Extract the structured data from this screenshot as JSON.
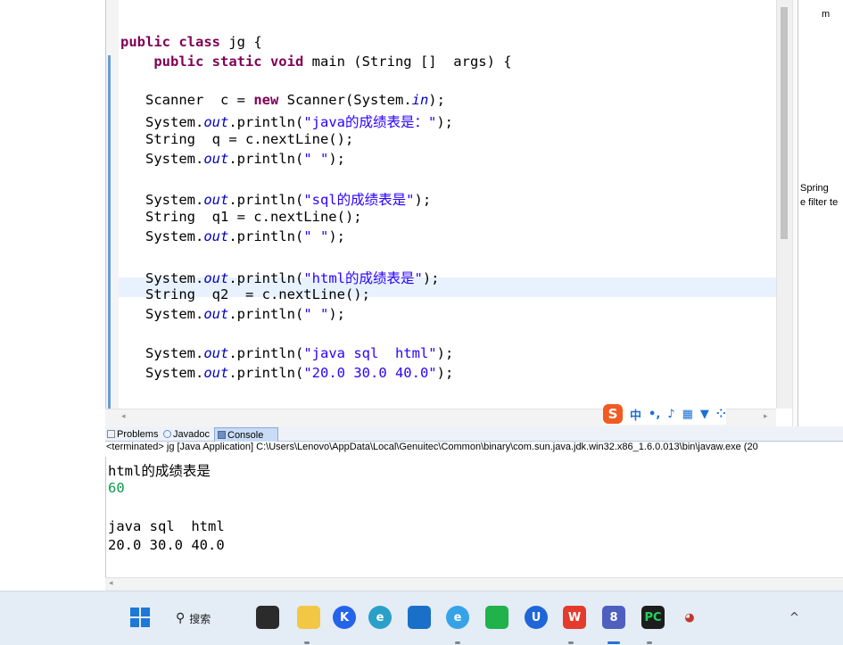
{
  "editor": {
    "lines": [
      {
        "parts": [
          [
            "kw",
            "public class "
          ],
          [
            "n",
            "jg {"
          ]
        ]
      },
      {
        "parts": [
          [
            "n",
            "    "
          ],
          [
            "kw",
            "public static void "
          ],
          [
            "n",
            "main (String []  args) {"
          ]
        ]
      },
      {
        "parts": [
          [
            "n",
            ""
          ]
        ]
      },
      {
        "parts": [
          [
            "n",
            "   Scanner  c = "
          ],
          [
            "kw",
            "new "
          ],
          [
            "n",
            "Scanner(System."
          ],
          [
            "fld",
            "in"
          ],
          [
            "n",
            ");"
          ]
        ]
      },
      {
        "parts": [
          [
            "n",
            "   System."
          ],
          [
            "fld",
            "out"
          ],
          [
            "n",
            ".println("
          ],
          [
            "str",
            "\"java的成绩表是：\""
          ],
          [
            "n",
            ");"
          ]
        ]
      },
      {
        "parts": [
          [
            "n",
            "   String  q = c.nextLine();"
          ]
        ]
      },
      {
        "parts": [
          [
            "n",
            "   System."
          ],
          [
            "fld",
            "out"
          ],
          [
            "n",
            ".println("
          ],
          [
            "str",
            "\" \""
          ],
          [
            "n",
            ");"
          ]
        ]
      },
      {
        "parts": [
          [
            "n",
            ""
          ]
        ]
      },
      {
        "parts": [
          [
            "n",
            "   System."
          ],
          [
            "fld",
            "out"
          ],
          [
            "n",
            ".println("
          ],
          [
            "str",
            "\"sql的成绩表是\""
          ],
          [
            "n",
            ");"
          ]
        ]
      },
      {
        "parts": [
          [
            "n",
            "   String  q1 = c.nextLine();"
          ]
        ]
      },
      {
        "parts": [
          [
            "n",
            "   System."
          ],
          [
            "fld",
            "out"
          ],
          [
            "n",
            ".println("
          ],
          [
            "str",
            "\" \""
          ],
          [
            "n",
            ");"
          ]
        ]
      },
      {
        "parts": [
          [
            "n",
            ""
          ]
        ]
      },
      {
        "parts": [
          [
            "n",
            "   System."
          ],
          [
            "fld",
            "out"
          ],
          [
            "n",
            ".println("
          ],
          [
            "str",
            "\"html的成绩表是\""
          ],
          [
            "n",
            ");"
          ]
        ]
      },
      {
        "parts": [
          [
            "n",
            "   String  q2  = c.nextLine();"
          ]
        ]
      },
      {
        "parts": [
          [
            "n",
            "   System."
          ],
          [
            "fld",
            "out"
          ],
          [
            "n",
            ".println("
          ],
          [
            "str",
            "\" \""
          ],
          [
            "n",
            ");"
          ]
        ]
      },
      {
        "parts": [
          [
            "n",
            ""
          ]
        ]
      },
      {
        "parts": [
          [
            "n",
            "   System."
          ],
          [
            "fld",
            "out"
          ],
          [
            "n",
            ".println("
          ],
          [
            "str",
            "\"java sql  html\""
          ],
          [
            "n",
            ");"
          ]
        ]
      },
      {
        "parts": [
          [
            "n",
            "   System."
          ],
          [
            "fld",
            "out"
          ],
          [
            "n",
            ".println("
          ],
          [
            "str",
            "\"20.0 30.0 40.0\""
          ],
          [
            "n",
            ");"
          ]
        ]
      }
    ]
  },
  "right_pane": {
    "top_label": "m",
    "spring_label": "Spring",
    "filter_label": "e filter te"
  },
  "ime_bar": {
    "logo": "S",
    "glyphs": [
      "中",
      "•,",
      "♪",
      "▦",
      "▼",
      "⁘"
    ]
  },
  "tabs": {
    "problems": "Problems",
    "javadoc": "Javadoc",
    "console": "Console"
  },
  "console": {
    "header": "<terminated> jg [Java Application] C:\\Users\\Lenovo\\AppData\\Local\\Genuitec\\Common\\binary\\com.sun.java.jdk.win32.x86_1.6.0.013\\bin\\javaw.exe (20",
    "lines": [
      {
        "text": "html的成绩表是",
        "input": false
      },
      {
        "text": "60",
        "input": true
      },
      {
        "text": "",
        "input": false
      },
      {
        "text": "java sql  html",
        "input": false
      },
      {
        "text": "20.0 30.0 40.0",
        "input": false
      }
    ]
  },
  "taskbar": {
    "search_label": "搜索",
    "tray_text": "^"
  }
}
